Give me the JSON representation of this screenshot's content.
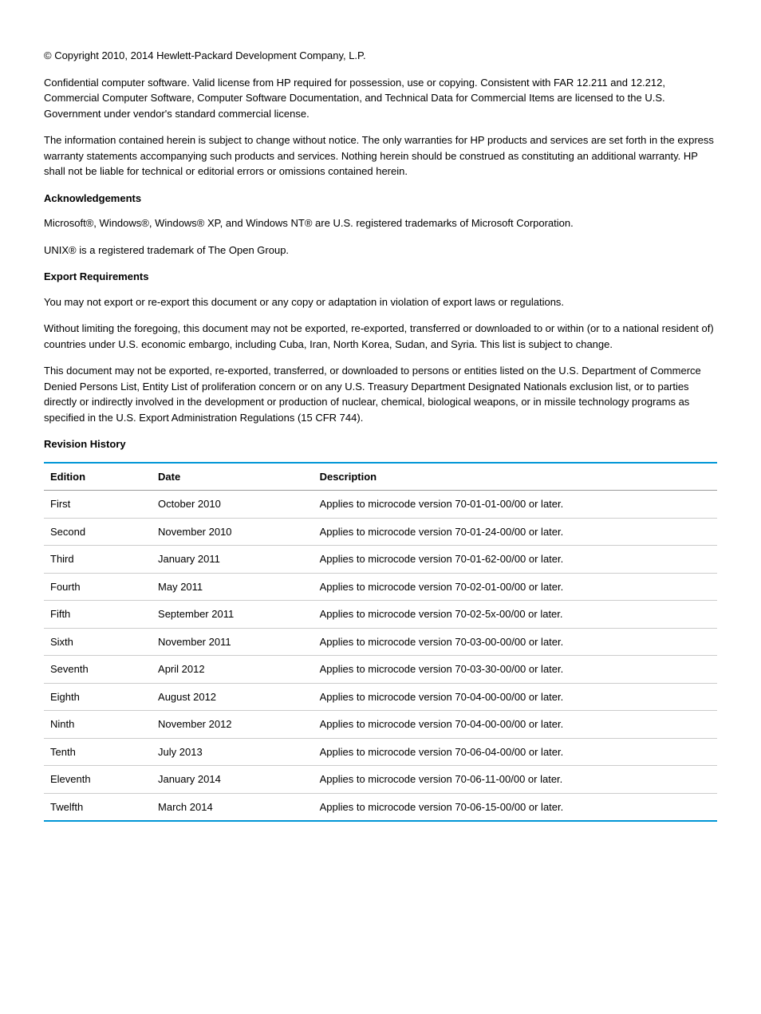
{
  "copyright": "© Copyright 2010, 2014 Hewlett-Packard Development Company, L.P.",
  "p1": "Confidential computer software. Valid license from HP required for possession, use or copying. Consistent with FAR 12.211 and 12.212, Commercial Computer Software, Computer Software Documentation, and Technical Data for Commercial Items are licensed to the U.S. Government under vendor's standard commercial license.",
  "p2": "The information contained herein is subject to change without notice. The only warranties for HP products and services are set forth in the express warranty statements accompanying such products and services. Nothing herein should be construed as constituting an additional warranty. HP shall not be liable for technical or editorial errors or omissions contained herein.",
  "ack_title": "Acknowledgements",
  "ack_p1": "Microsoft®, Windows®, Windows® XP, and Windows NT® are U.S. registered trademarks of Microsoft Corporation.",
  "ack_p2": "UNIX® is a registered trademark of The Open Group.",
  "exp_title": "Export Requirements",
  "exp_p1": "You may not export or re-export this document or any copy or adaptation in violation of export laws or regulations.",
  "exp_p2": "Without limiting the foregoing, this document may not be exported, re-exported, transferred or downloaded to or within (or to a national resident of) countries under U.S. economic embargo, including Cuba, Iran, North Korea, Sudan, and Syria. This list is subject to change.",
  "exp_p3": "This document may not be exported, re-exported, transferred, or downloaded to persons or entities listed on the U.S. Department of Commerce Denied Persons List, Entity List of proliferation concern or on any U.S. Treasury Department Designated Nationals exclusion list, or to parties directly or indirectly involved in the development or production of nuclear, chemical, biological weapons, or in missile technology programs as specified in the U.S. Export Administration Regulations (15 CFR 744).",
  "rev_title": "Revision History",
  "table": {
    "headers": {
      "edition": "Edition",
      "date": "Date",
      "desc": "Description"
    },
    "rows": [
      {
        "edition": "First",
        "date": "October 2010",
        "desc": "Applies to microcode version 70-01-01-00/00 or later."
      },
      {
        "edition": "Second",
        "date": "November 2010",
        "desc": "Applies to microcode version 70-01-24-00/00 or later."
      },
      {
        "edition": "Third",
        "date": "January 2011",
        "desc": "Applies to microcode version 70-01-62-00/00 or later."
      },
      {
        "edition": "Fourth",
        "date": "May 2011",
        "desc": "Applies to microcode version 70-02-01-00/00 or later."
      },
      {
        "edition": "Fifth",
        "date": "September 2011",
        "desc": "Applies to microcode version 70-02-5x-00/00 or later."
      },
      {
        "edition": "Sixth",
        "date": "November 2011",
        "desc": "Applies to microcode version 70-03-00-00/00 or later."
      },
      {
        "edition": "Seventh",
        "date": "April 2012",
        "desc": "Applies to microcode version 70-03-30-00/00 or later."
      },
      {
        "edition": "Eighth",
        "date": "August 2012",
        "desc": "Applies to microcode version 70-04-00-00/00 or later."
      },
      {
        "edition": "Ninth",
        "date": "November 2012",
        "desc": "Applies to microcode version 70-04-00-00/00 or later."
      },
      {
        "edition": "Tenth",
        "date": "July 2013",
        "desc": "Applies to microcode version 70-06-04-00/00 or later."
      },
      {
        "edition": "Eleventh",
        "date": "January 2014",
        "desc": "Applies to microcode version 70-06-11-00/00 or later."
      },
      {
        "edition": "Twelfth",
        "date": "March 2014",
        "desc": "Applies to microcode version 70-06-15-00/00 or later."
      }
    ]
  }
}
